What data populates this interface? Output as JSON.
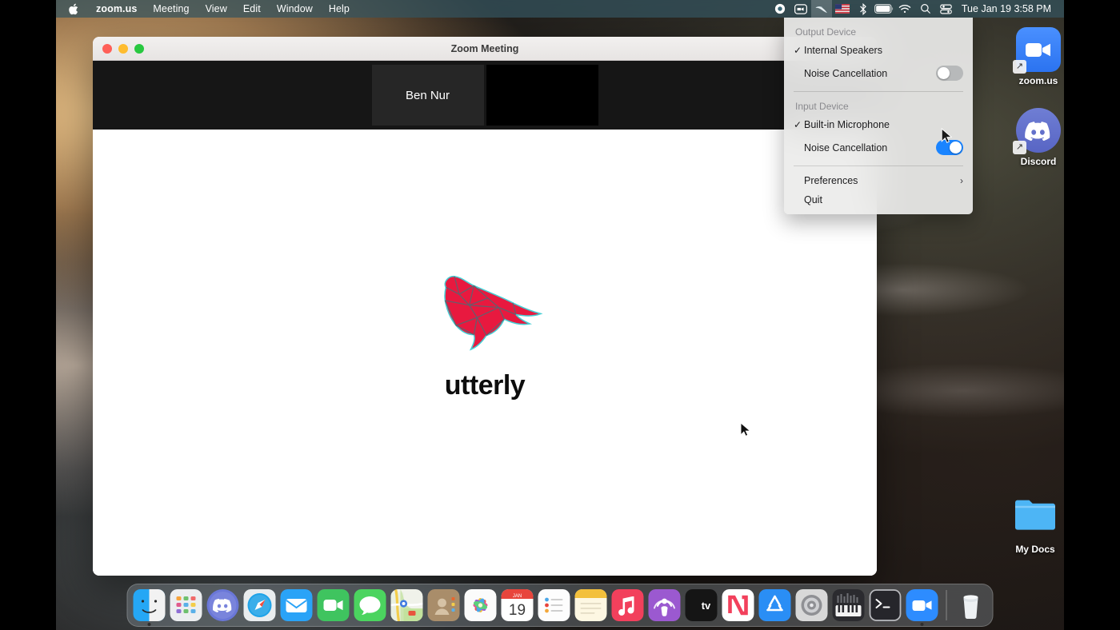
{
  "menubar": {
    "apple_icon": "apple-logo",
    "items": [
      {
        "label": "zoom.us",
        "bold": true
      },
      {
        "label": "Meeting",
        "bold": false
      },
      {
        "label": "View",
        "bold": false
      },
      {
        "label": "Edit",
        "bold": false
      },
      {
        "label": "Window",
        "bold": false
      },
      {
        "label": "Help",
        "bold": false
      }
    ],
    "status_icons": [
      "screen-record-icon",
      "zoom-camera-icon",
      "utterly-bird-icon",
      "us-flag-input-icon",
      "bluetooth-icon",
      "battery-icon",
      "wifi-icon",
      "search-icon",
      "control-center-icon"
    ],
    "clock": "Tue Jan 19  3:58 PM"
  },
  "audio_menu": {
    "output_section_title": "Output Device",
    "output_device": {
      "label": "Internal Speakers",
      "checked": true,
      "check_glyph": "✓"
    },
    "output_noise_cancellation": {
      "label": "Noise Cancellation",
      "state": "off"
    },
    "input_section_title": "Input Device",
    "input_device": {
      "label": "Built-in Microphone",
      "checked": true,
      "check_glyph": "✓"
    },
    "input_noise_cancellation": {
      "label": "Noise Cancellation",
      "state": "on"
    },
    "preferences": {
      "label": "Preferences",
      "submenu_glyph": "›"
    },
    "quit": {
      "label": "Quit"
    },
    "accent_on_color": "#1a84ff",
    "track_off_color": "#b7b9ba"
  },
  "zoom_window": {
    "title": "Zoom Meeting",
    "traffic_lights": [
      "close-button",
      "minimize-button",
      "maximize-button"
    ],
    "participants": [
      {
        "name": "Ben Nur",
        "video_off": true
      },
      {
        "name": "",
        "video_off": true
      }
    ],
    "shared_content": {
      "logo_name": "utterly-bird-logo",
      "brand": "utterly",
      "logo_color": "#e8193f"
    }
  },
  "desktop_icons": [
    {
      "name": "zoom.us",
      "icon": "zoom-app-icon",
      "alias": true
    },
    {
      "name": "Discord",
      "icon": "discord-app-icon",
      "alias": true
    },
    {
      "name": "My Docs",
      "icon": "folder-icon",
      "alias": false
    }
  ],
  "dock": {
    "items": [
      {
        "label": "Finder",
        "icon": "finder-icon",
        "running": true
      },
      {
        "label": "Launchpad",
        "icon": "launchpad-icon",
        "running": false
      },
      {
        "label": "Discord",
        "icon": "discord-icon",
        "running": false
      },
      {
        "label": "Safari",
        "icon": "safari-icon",
        "running": false
      },
      {
        "label": "Mail",
        "icon": "mail-icon",
        "running": false
      },
      {
        "label": "FaceTime",
        "icon": "facetime-icon",
        "running": false
      },
      {
        "label": "Messages",
        "icon": "messages-icon",
        "running": false
      },
      {
        "label": "Maps",
        "icon": "maps-icon",
        "running": false
      },
      {
        "label": "Contacts",
        "icon": "contacts-icon",
        "running": false
      },
      {
        "label": "Photos",
        "icon": "photos-icon",
        "running": false
      },
      {
        "label": "Calendar",
        "icon": "calendar-icon",
        "running": false,
        "month": "JAN",
        "day": "19"
      },
      {
        "label": "Reminders",
        "icon": "reminders-icon",
        "running": false
      },
      {
        "label": "Notes",
        "icon": "notes-icon",
        "running": false
      },
      {
        "label": "Music",
        "icon": "music-icon",
        "running": false
      },
      {
        "label": "Podcasts",
        "icon": "podcasts-icon",
        "running": false
      },
      {
        "label": "Apple TV",
        "icon": "appletv-icon",
        "running": false
      },
      {
        "label": "News",
        "icon": "news-icon",
        "running": false
      },
      {
        "label": "App Store",
        "icon": "appstore-icon",
        "running": false
      },
      {
        "label": "System Preferences",
        "icon": "system-preferences-icon",
        "running": false
      },
      {
        "label": "GarageBand",
        "icon": "garageband-icon",
        "running": false
      },
      {
        "label": "Terminal",
        "icon": "terminal-icon",
        "running": false
      },
      {
        "label": "Zoom",
        "icon": "zoom-icon",
        "running": true
      }
    ],
    "trash": {
      "label": "Trash",
      "icon": "trash-icon"
    }
  }
}
